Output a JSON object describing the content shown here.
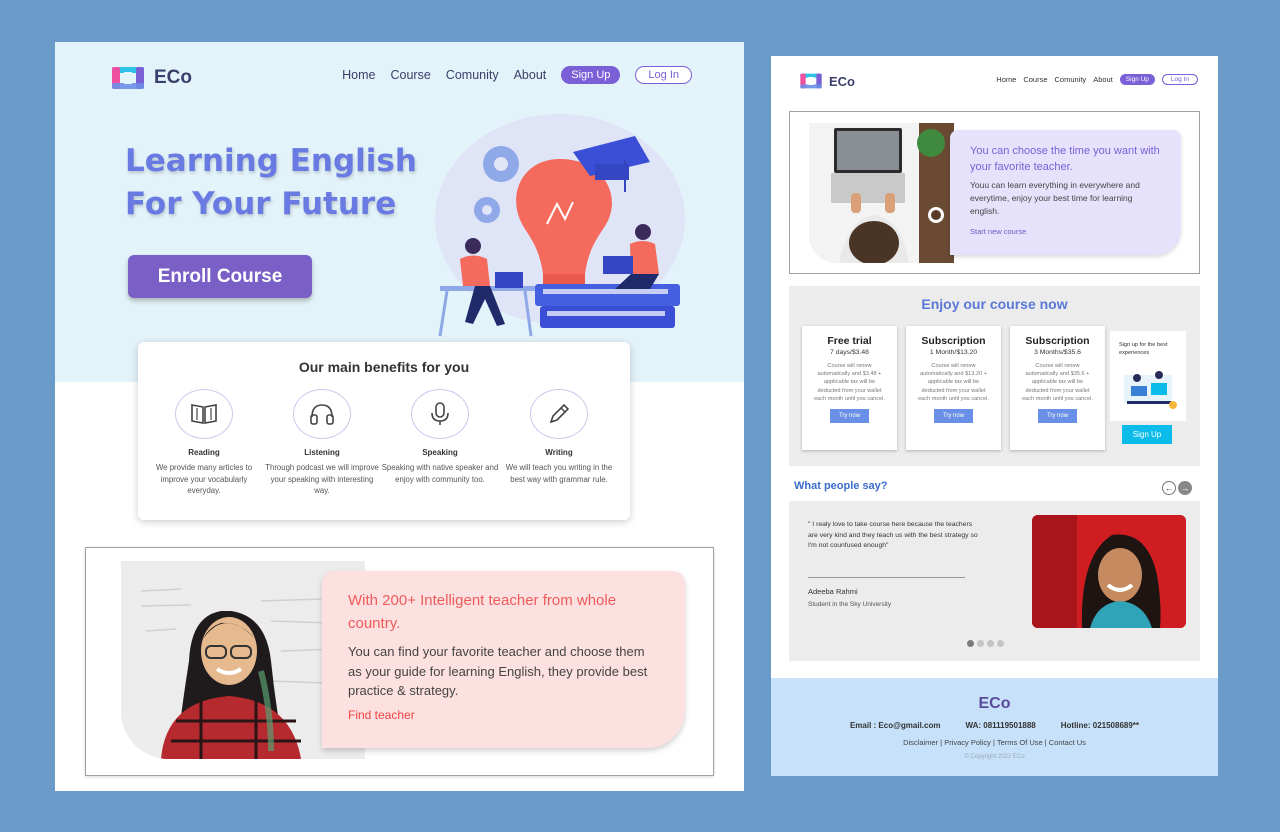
{
  "colors": {
    "background": "#6b9bc9",
    "accent": "#7a5fd6",
    "hero_bg": "#e2f3f9",
    "pink_card": "#fde0e0",
    "purple_card": "#e6e2fb",
    "footer_bg": "#c6e1f9"
  },
  "left": {
    "brand": "ECo",
    "nav": {
      "home": "Home",
      "course": "Course",
      "community": "Comunity",
      "about": "About",
      "signup": "Sign Up",
      "login": "Log In"
    },
    "hero": {
      "title_line1": "Learning English",
      "title_line2": "For Your Future",
      "cta": "Enroll Course",
      "illustration": "lightbulb-study-illustration"
    },
    "benefits": {
      "title": "Our main benefits for you",
      "items": [
        {
          "title": "Reading",
          "desc": "We provide many articles to improve your vocabularly everyday.",
          "icon": "book-icon"
        },
        {
          "title": "Listening",
          "desc": "Through podcast we will improve your speaking with interesting way.",
          "icon": "headphones-icon"
        },
        {
          "title": "Speaking",
          "desc": "Speaking with native speaker and enjoy with community too.",
          "icon": "microphone-icon"
        },
        {
          "title": "Writing",
          "desc": "We will teach you writing in the best way with grammar rule.",
          "icon": "pencil-icon"
        }
      ]
    },
    "teachers": {
      "title": "With 200+ Intelligent teacher from whole country.",
      "desc": "You can find your favorite teacher and choose them as your guide for learning English, they provide best practice & strategy.",
      "link": "Find teacher"
    }
  },
  "right": {
    "brand": "ECo",
    "nav": {
      "home": "Home",
      "course": "Course",
      "community": "Comunity",
      "about": "About",
      "signup": "Sign Up",
      "login": "Log In"
    },
    "choose": {
      "title": "You can choose the time you want with your favorite teacher.",
      "desc": "Youu can learn everything in everywhere and everytime, enjoy your best time for learning english.",
      "link": "Start new course"
    },
    "pricing": {
      "title": "Enjoy our course now",
      "plans": [
        {
          "title": "Free trial",
          "price": "7 days/$3.48",
          "desc": "Course will renew automatically and $3.48 + applicable tax will be deducted from your wallet each month until you cancel.",
          "cta": "Try now"
        },
        {
          "title": "Subscription",
          "price": "1 Month/$13.20",
          "desc": "Course will renew automatically and $13.20 + applicable tax will be deducted from your wallet each month until you cancel.",
          "cta": "Try now"
        },
        {
          "title": "Subscription",
          "price": "3 Months/$35.6",
          "desc": "Course will renew automatically and $35.6 + applicable tax will be deducted from your wallet each month until you cancel.",
          "cta": "Try now"
        }
      ],
      "signup_text": "Sign up for the best experiences",
      "signup_btn": "Sign Up"
    },
    "testimonials": {
      "title": "What people say?",
      "quote": "\" I realy love to take course here because the teachers are very kind and they teach us with the best strategy so I'm not counfused enough\"",
      "name": "Adeeba Rahmi",
      "school": "Student in the Sky University",
      "dots": 4,
      "active_dot": 1
    },
    "footer": {
      "brand": "ECo",
      "email": "Email : Eco@gmail.com",
      "wa": "WA: 081119501888",
      "hotline": "Hotline: 021508689**",
      "links": "Disclaimer | Privacy Policy | Terms Of Use | Contact Us",
      "copyright": "© Copyright 2022 ECo"
    }
  }
}
